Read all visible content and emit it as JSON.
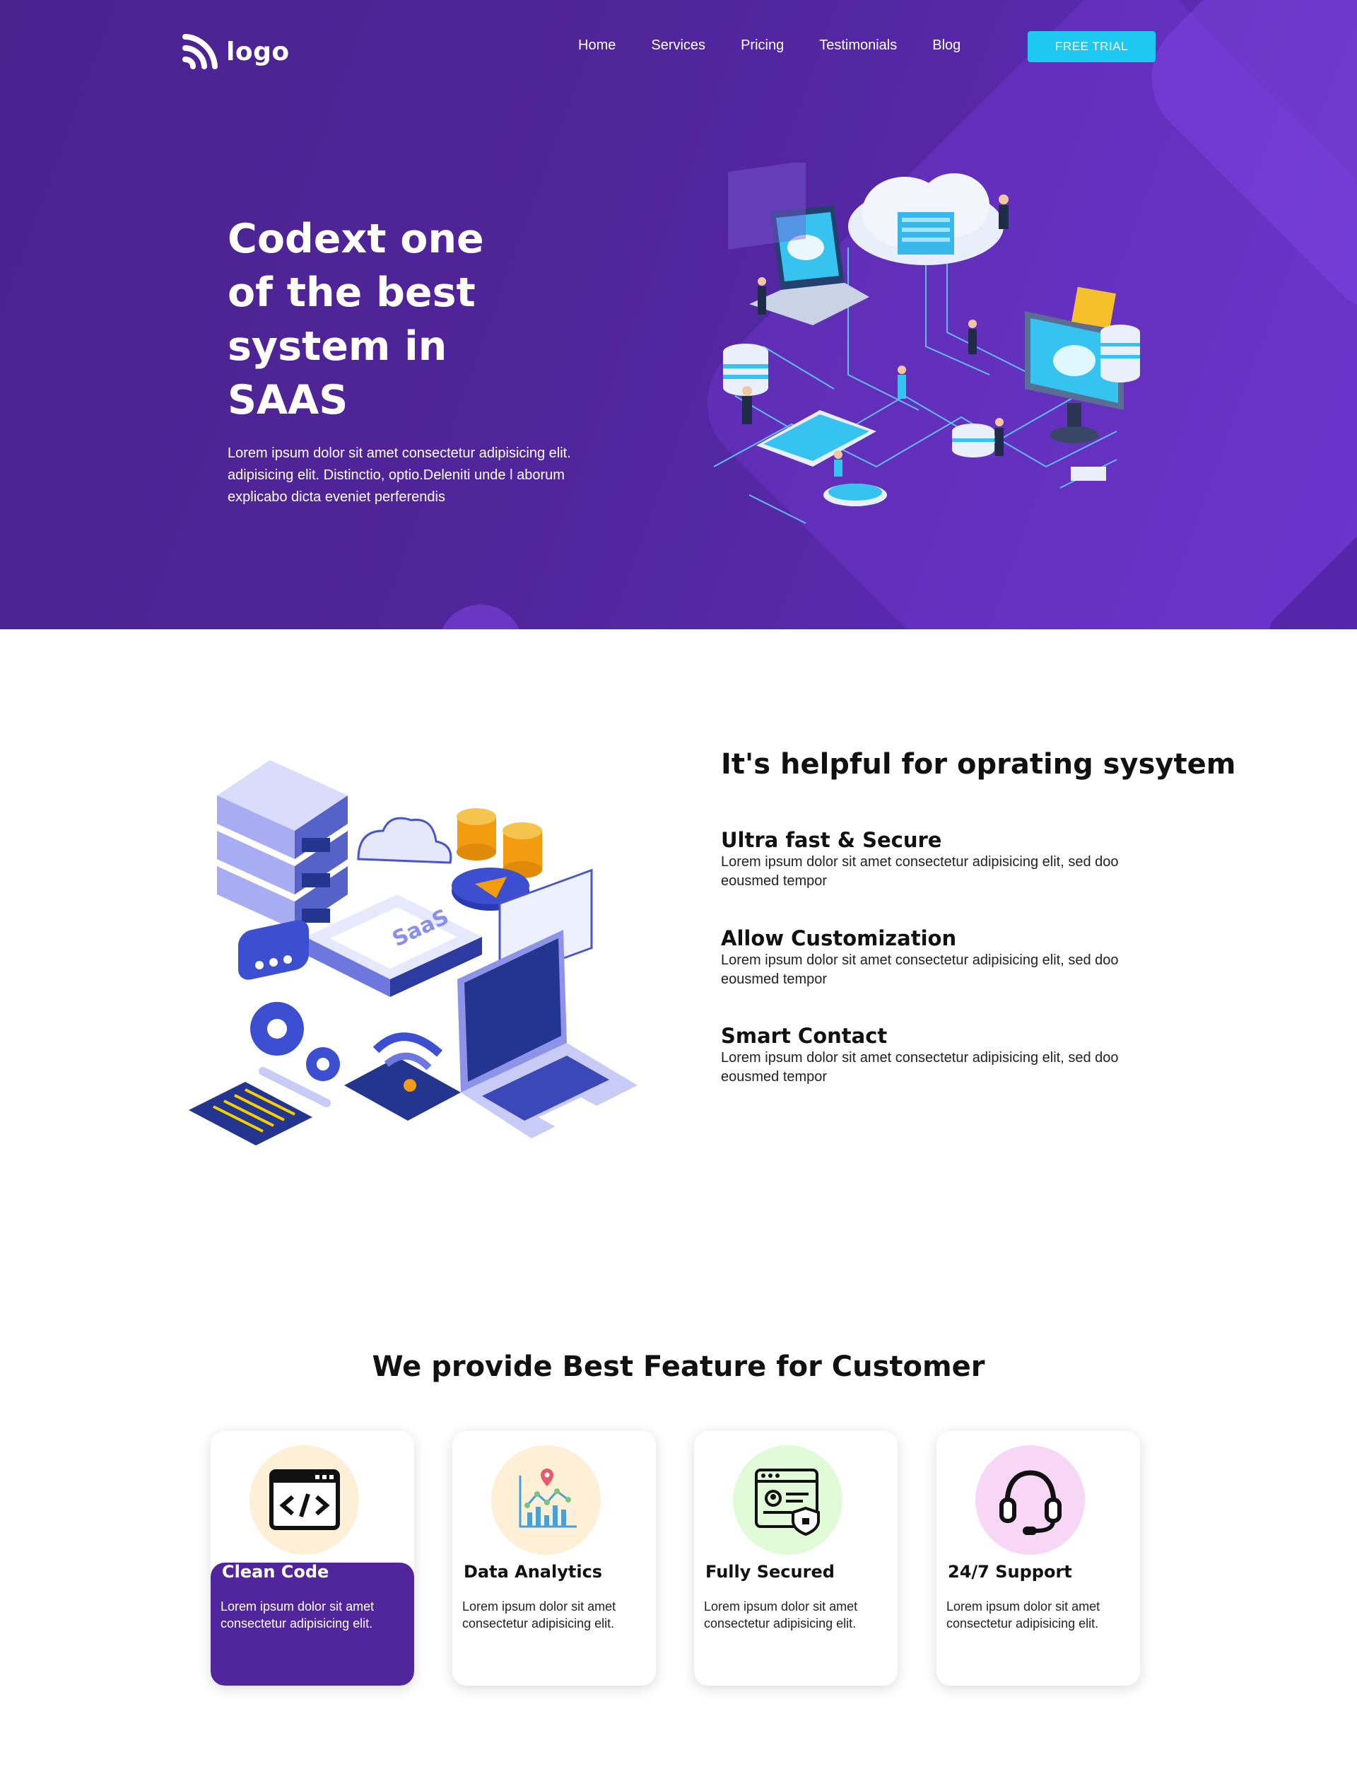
{
  "brand": {
    "logo_text": "logo",
    "accent": "#1ec8f0",
    "primary": "#51259b"
  },
  "nav": {
    "items": [
      {
        "label": "Home"
      },
      {
        "label": "Services"
      },
      {
        "label": "Pricing"
      },
      {
        "label": "Testimonials"
      },
      {
        "label": "Blog"
      }
    ],
    "cta_label": "FREE TRIAL"
  },
  "hero": {
    "title": "Codext one of the best system in SAAS",
    "text": "Lorem ipsum dolor sit amet consectetur adipisicing elit. adipisicing elit. Distinctio, optio.Deleniti unde l aborum explicabo dicta eveniet perferendis",
    "illustration": "cloud-network-isometric-illustration"
  },
  "helpful": {
    "title": "It's helpful for oprating sysytem",
    "illustration": "saas-isometric-illustration",
    "features": [
      {
        "title": "Ultra fast & Secure",
        "text": "Lorem ipsum dolor sit amet consectetur adipisicing elit, sed doo eousmed tempor"
      },
      {
        "title": "Allow Customization",
        "text": "Lorem ipsum dolor sit amet consectetur adipisicing elit, sed doo eousmed tempor"
      },
      {
        "title": "Smart Contact",
        "text": "Lorem ipsum dolor sit amet consectetur adipisicing elit, sed doo eousmed tempor"
      }
    ]
  },
  "best": {
    "title": "We provide Best Feature for Customer",
    "cards": [
      {
        "title": "Clean Code",
        "text": "Lorem ipsum dolor sit amet consectetur adipisicing elit.",
        "icon": "code-window-icon",
        "circle_color": "#fdf0d6",
        "active": true
      },
      {
        "title": "Data Analytics",
        "text": "Lorem ipsum dolor sit amet consectetur adipisicing elit.",
        "icon": "analytics-chart-icon",
        "circle_color": "#fdf0d6",
        "active": false
      },
      {
        "title": "Fully Secured",
        "text": "Lorem ipsum dolor sit amet consectetur adipisicing elit.",
        "icon": "secure-profile-icon",
        "circle_color": "#e1fbd8",
        "active": false
      },
      {
        "title": "24/7 Support",
        "text": "Lorem ipsum dolor sit amet consectetur adipisicing elit.",
        "icon": "headset-icon",
        "circle_color": "#f8d7f6",
        "active": false
      }
    ]
  }
}
